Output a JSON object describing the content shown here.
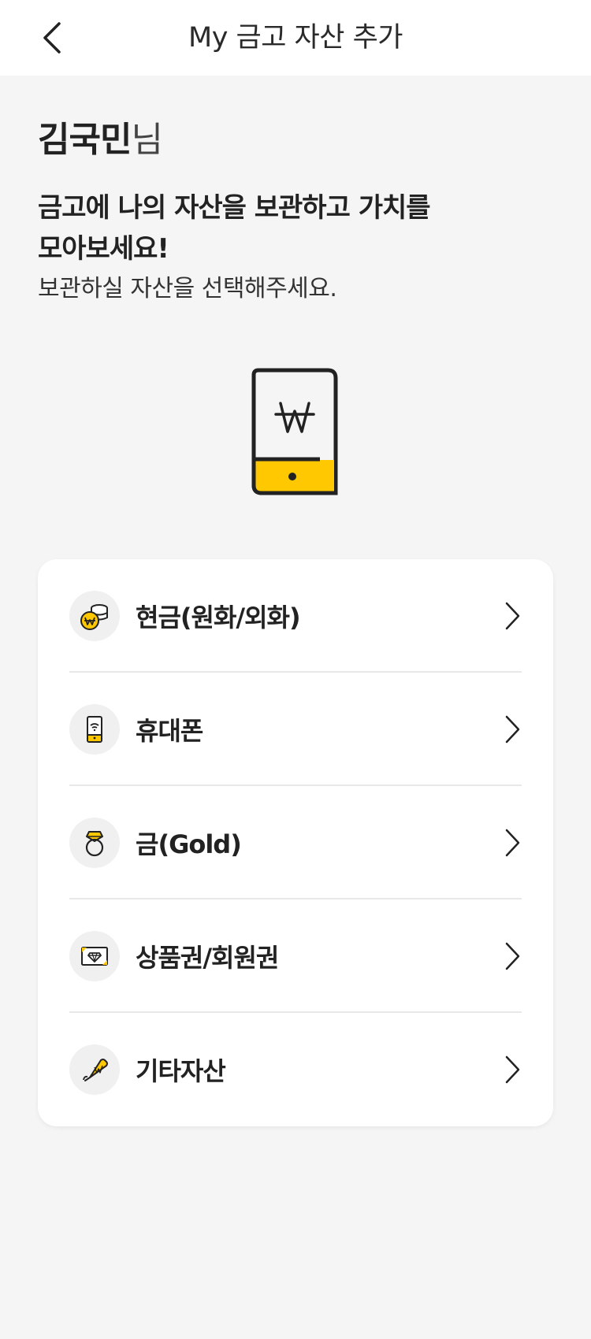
{
  "header": {
    "title": "My 금고 자산 추가"
  },
  "greeting": {
    "name": "김국민",
    "suffix": "님"
  },
  "headline": {
    "line1": "금고에 나의 자산을 보관하고 가치를",
    "line2": "모아보세요!"
  },
  "subtext": "보관하실 자산을 선택해주세요.",
  "colors": {
    "accent": "#FFC800",
    "icon_bg": "#F0F0F0",
    "background": "#F5F5F5"
  },
  "assets": [
    {
      "label": "현금(원화/외화)",
      "icon": "cash-coins-icon"
    },
    {
      "label": "휴대폰",
      "icon": "mobile-phone-icon"
    },
    {
      "label": "금(Gold)",
      "icon": "gold-ring-icon"
    },
    {
      "label": "상품권/회원권",
      "icon": "gift-voucher-icon"
    },
    {
      "label": "기타자산",
      "icon": "other-asset-tag-icon"
    }
  ]
}
